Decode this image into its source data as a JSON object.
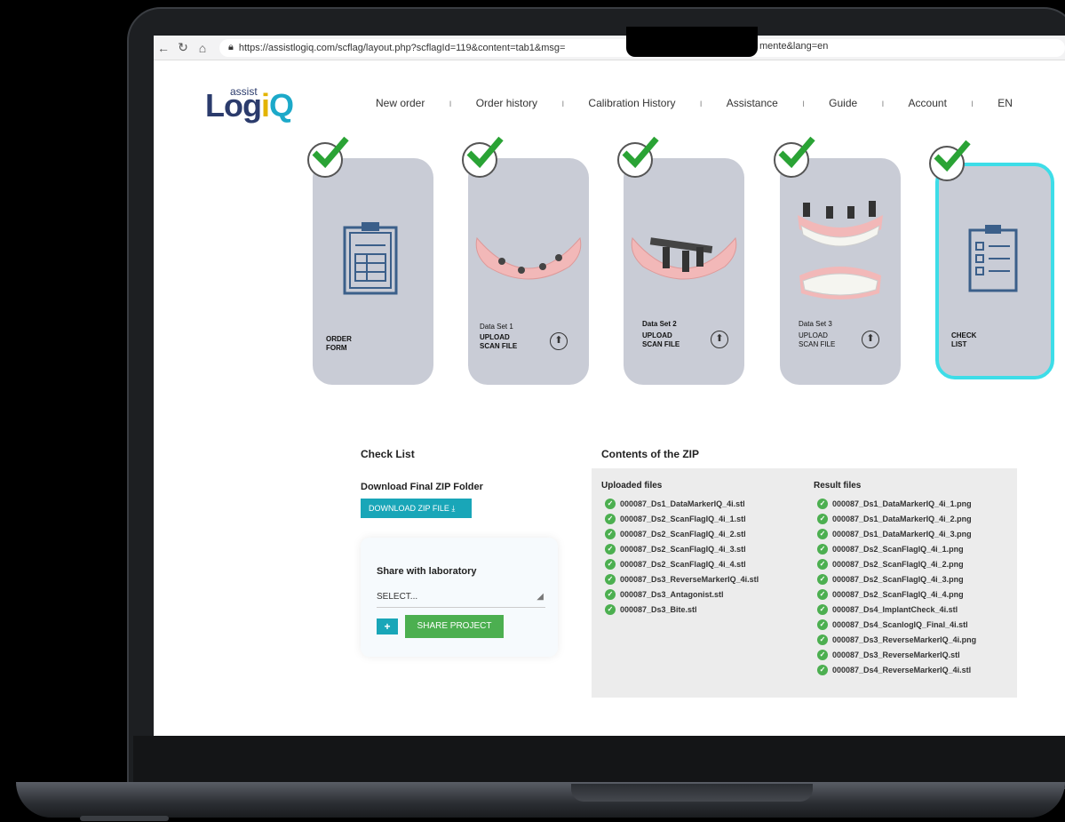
{
  "browser": {
    "url_visible": "https://assistlogiq.com/scflag/layout.php?scflagId=119&content=tab1&msg=",
    "url_tail": "mente&lang=en"
  },
  "logo": {
    "small": "assist",
    "main_a": "Log",
    "main_b": "i",
    "main_c": "Q"
  },
  "menu": [
    "New order",
    "Order history",
    "Calibration History",
    "Assistance",
    "Guide",
    "Account",
    "EN"
  ],
  "cards": [
    {
      "title_line1": "ORDER",
      "title_line2": "FORM",
      "set": ""
    },
    {
      "title_line1": "UPLOAD",
      "title_line2": "SCAN FILE",
      "set": "Data Set 1"
    },
    {
      "title_line1": "UPLOAD",
      "title_line2": "SCAN FILE",
      "set": "Data Set 2"
    },
    {
      "title_line1": "UPLOAD",
      "title_line2": "SCAN FILE",
      "set": "Data Set 3"
    },
    {
      "title_line1": "CHECK",
      "title_line2": "LIST",
      "set": ""
    }
  ],
  "checklist": {
    "heading": "Check List",
    "download_heading": "Download Final ZIP Folder",
    "download_button": "DOWNLOAD ZIP FILE",
    "share_heading": "Share with laboratory",
    "select_placeholder": "SELECT...",
    "add_button": "+",
    "share_button": "SHARE PROJECT"
  },
  "zip": {
    "heading": "Contents of the ZIP",
    "uploaded_heading": "Uploaded files",
    "result_heading": "Result files",
    "uploaded": [
      "000087_Ds1_DataMarkerIQ_4i.stl",
      "000087_Ds2_ScanFlagIQ_4i_1.stl",
      "000087_Ds2_ScanFlagIQ_4i_2.stl",
      "000087_Ds2_ScanFlagIQ_4i_3.stl",
      "000087_Ds2_ScanFlagIQ_4i_4.stl",
      "000087_Ds3_ReverseMarkerIQ_4i.stl",
      "000087_Ds3_Antagonist.stl",
      "000087_Ds3_Bite.stl"
    ],
    "results": [
      "000087_Ds1_DataMarkerIQ_4i_1.png",
      "000087_Ds1_DataMarkerIQ_4i_2.png",
      "000087_Ds1_DataMarkerIQ_4i_3.png",
      "000087_Ds2_ScanFlagIQ_4i_1.png",
      "000087_Ds2_ScanFlagIQ_4i_2.png",
      "000087_Ds2_ScanFlagIQ_4i_3.png",
      "000087_Ds2_ScanFlagIQ_4i_4.png",
      "000087_Ds4_ImplantCheck_4i.stl",
      "000087_Ds4_ScanlogIQ_Final_4i.stl",
      "000087_Ds3_ReverseMarkerIQ_4i.png",
      "000087_Ds3_ReverseMarkerIQ.stl",
      "000087_Ds4_ReverseMarkerIQ_4i.stl"
    ]
  },
  "colors": {
    "accent": "#19a6b8",
    "share": "#4caf50",
    "active_card": "#3ddde8",
    "card": "#c9ccd6",
    "navy": "#2b3b6c"
  }
}
